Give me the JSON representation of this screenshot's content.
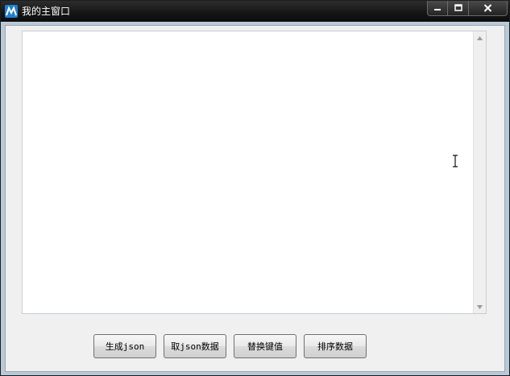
{
  "window": {
    "title": "我的主窗口",
    "app_icon": "app-logo-icon",
    "caption_icons": [
      "minimize-icon",
      "maximize-icon",
      "close-icon"
    ]
  },
  "editor": {
    "content": "",
    "cursor_icon": "text-cursor-icon"
  },
  "buttons": [
    {
      "label": "生成json"
    },
    {
      "label": "取json数据"
    },
    {
      "label": "替换键值"
    },
    {
      "label": "排序数据"
    }
  ],
  "colors": {
    "titlebar": "#151515",
    "client": "#f0f0f0",
    "app_icon": "#1f7fd1"
  }
}
